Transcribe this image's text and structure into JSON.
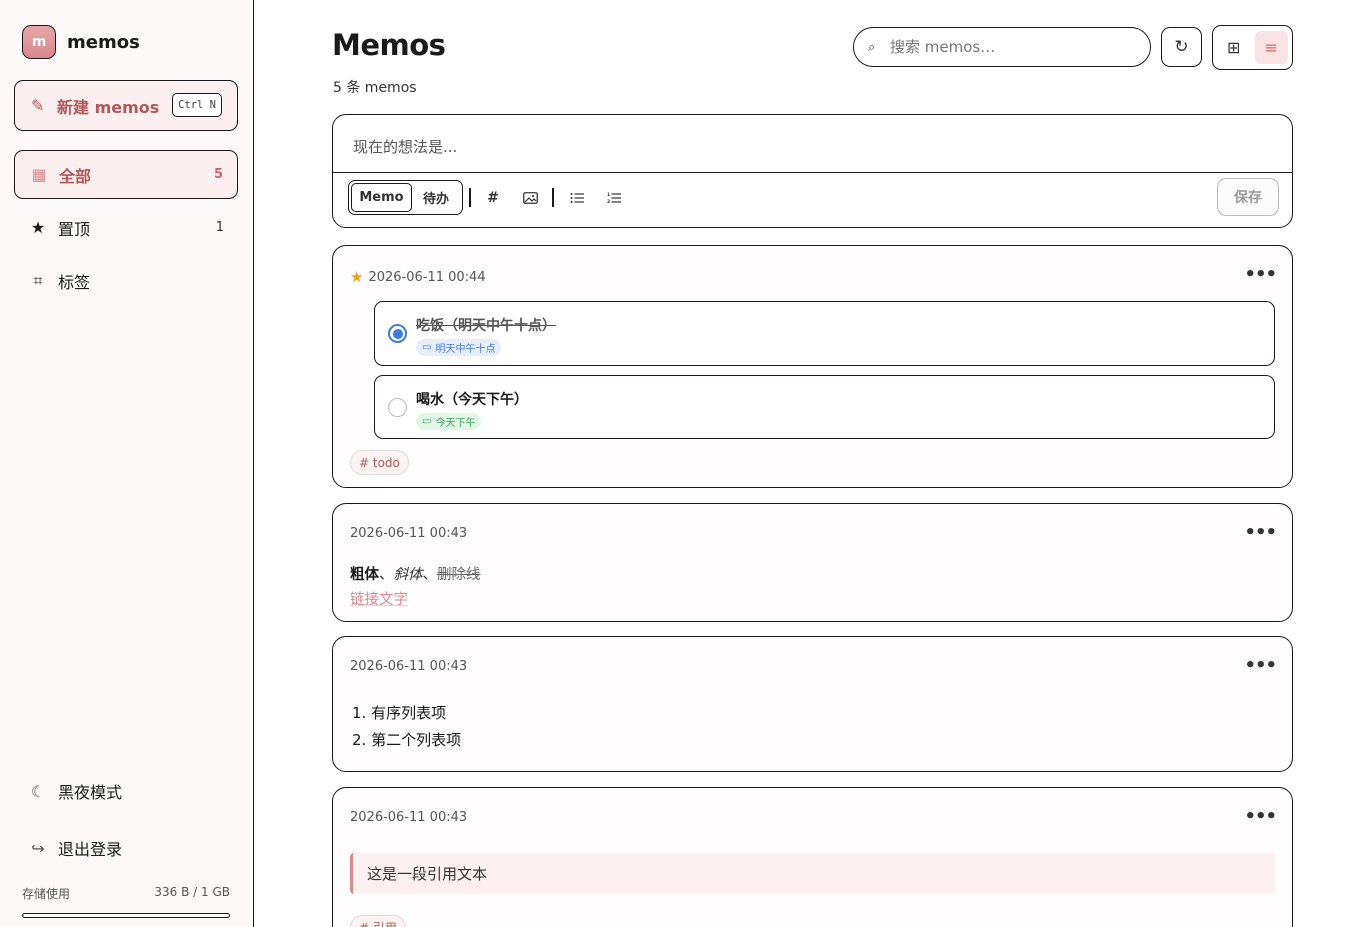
{
  "brand": {
    "logo_letter": "m",
    "name": "memos"
  },
  "sidebar": {
    "new_button": {
      "label": "新建 memos",
      "shortcut": "Ctrl N"
    },
    "nav": [
      {
        "label": "全部",
        "count": "5",
        "icon": "grid-icon"
      },
      {
        "label": "置顶",
        "count": "1",
        "icon": "star-icon"
      },
      {
        "label": "标签",
        "count": "",
        "icon": "hash-icon"
      }
    ],
    "dark_mode_label": "黑夜模式",
    "logout_label": "退出登录",
    "storage": {
      "label": "存储使用",
      "value": "336 B / 1 GB",
      "used_fraction": 3e-07
    }
  },
  "header": {
    "title": "Memos",
    "subtitle": "5 条 memos",
    "search_placeholder": "搜索 memos…"
  },
  "editor": {
    "placeholder": "现在的想法是...",
    "modes": [
      "Memo",
      "待办"
    ],
    "active_mode": "Memo",
    "save_label": "保存"
  },
  "memos": [
    {
      "timestamp": "2026-06-11 00:44",
      "pinned": true,
      "todos": [
        {
          "title": "吃饭（明天中午十点）",
          "done": true,
          "due": "明天中午十点"
        },
        {
          "title": "喝水（今天下午）",
          "done": false,
          "due": "今天下午"
        }
      ],
      "tag": "# todo"
    },
    {
      "timestamp": "2026-06-11 00:43",
      "bold": "粗体",
      "sep1": "、",
      "italic": "斜体",
      "sep2": "、",
      "strike": "删除线",
      "link": "链接文字"
    },
    {
      "timestamp": "2026-06-11 00:43",
      "list": [
        "1. 有序列表项",
        "2. 第二个列表项"
      ]
    },
    {
      "timestamp": "2026-06-11 00:43",
      "quote": "这是一段引用文本",
      "tag": "# 引用"
    }
  ],
  "colors": {
    "accent": "#d98a8d",
    "accent_text": "#b2575a",
    "pin": "#e8a317",
    "todo_checked": "#3b7bea"
  }
}
